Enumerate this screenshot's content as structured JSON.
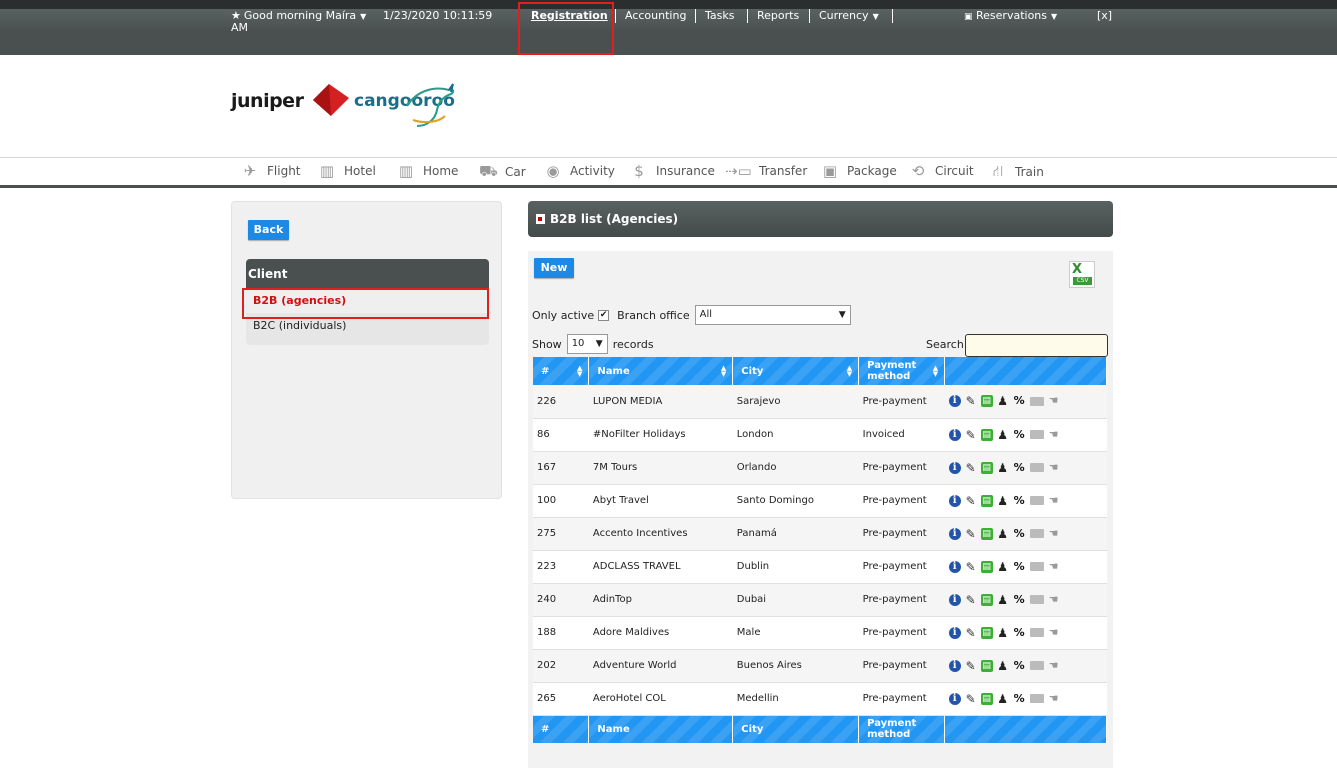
{
  "topbar": {
    "greeting": "Good morning Maíra",
    "datetime": "1/23/2020 10:11:59",
    "ampm": "AM",
    "nav": [
      "Registration",
      "Accounting",
      "Tasks",
      "Reports",
      "Currency"
    ],
    "reservations": "Reservations",
    "close": "[x]"
  },
  "logo": {
    "juniper": "juniper",
    "cangooroo": "cangooroo"
  },
  "products": [
    {
      "label": "Flight",
      "icon": "plane-icon"
    },
    {
      "label": "Hotel",
      "icon": "building-icon"
    },
    {
      "label": "Home",
      "icon": "building-icon"
    },
    {
      "label": "Car",
      "icon": "car-icon"
    },
    {
      "label": "Activity",
      "icon": "camera-icon"
    },
    {
      "label": "Insurance",
      "icon": "dollar-icon"
    },
    {
      "label": "Transfer",
      "icon": "shuttle-icon"
    },
    {
      "label": "Package",
      "icon": "suitcase-icon"
    },
    {
      "label": "Circuit",
      "icon": "loop-icon"
    },
    {
      "label": "Train",
      "icon": "train-icon"
    }
  ],
  "sidebar": {
    "back_label": "Back",
    "section_title": "Client",
    "items": [
      "B2B (agencies)",
      "B2C (individuals)"
    ]
  },
  "main": {
    "title": "B2B list (Agencies)",
    "new_label": "New",
    "csv_label": "CSV",
    "only_active_label": "Only active",
    "branch_label": "Branch office",
    "branch_value": "All",
    "show_label": "Show",
    "show_value": "10",
    "records_label": "records",
    "search_label": "Search",
    "columns": [
      "#",
      "Name",
      "City",
      "Payment method"
    ],
    "rows": [
      [
        "226",
        "LUPON MEDIA",
        "Sarajevo",
        "Pre-payment"
      ],
      [
        "86",
        "#NoFilter Holidays",
        "London",
        "Invoiced"
      ],
      [
        "167",
        "7M Tours",
        "Orlando",
        "Pre-payment"
      ],
      [
        "100",
        "Abyt Travel",
        "Santo Domingo",
        "Pre-payment"
      ],
      [
        "275",
        "Accento Incentives",
        "Panamá",
        "Pre-payment"
      ],
      [
        "223",
        "ADCLASS TRAVEL",
        "Dublin",
        "Pre-payment"
      ],
      [
        "240",
        "AdinTop",
        "Dubai",
        "Pre-payment"
      ],
      [
        "188",
        "Adore Maldives",
        "Male",
        "Pre-payment"
      ],
      [
        "202",
        "Adventure World",
        "Buenos Aires",
        "Pre-payment"
      ],
      [
        "265",
        "AeroHotel COL",
        "Medellin",
        "Pre-payment"
      ]
    ]
  },
  "colors": {
    "accent": "#1e88e5",
    "header_dark": "#4a5050",
    "highlight": "#e02020"
  }
}
